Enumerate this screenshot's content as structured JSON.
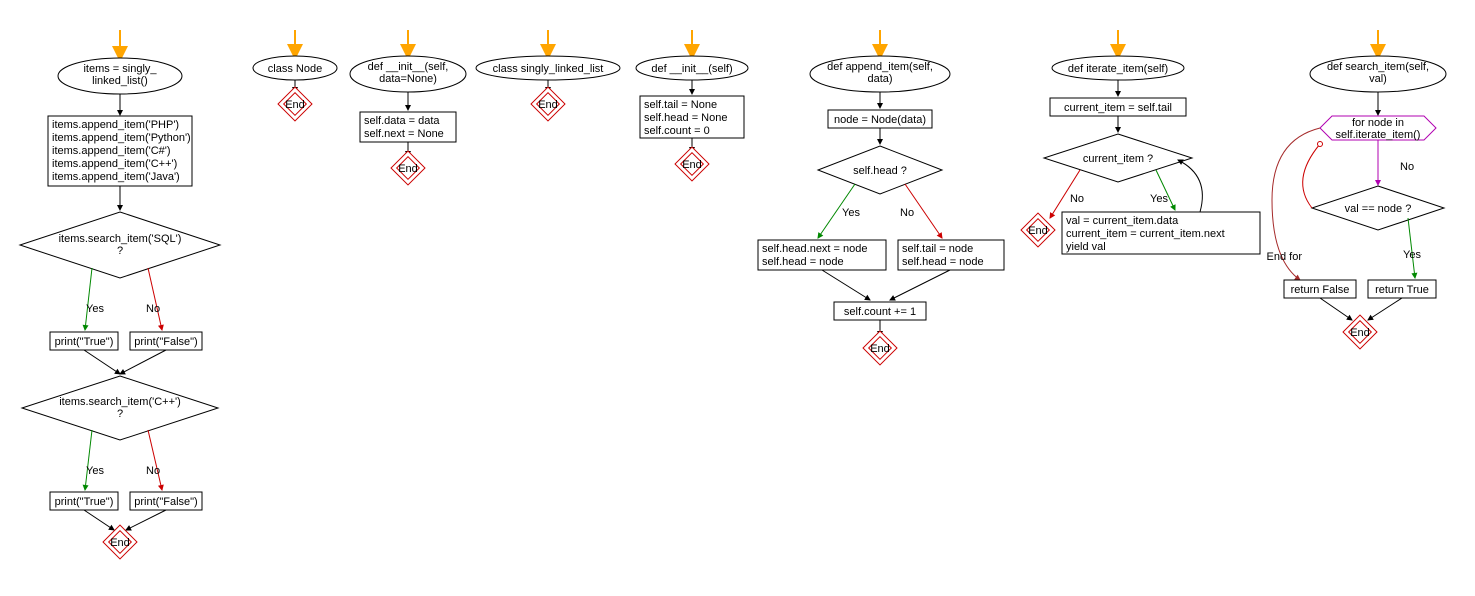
{
  "fc1": {
    "start_text_1": "items = singly_",
    "start_text_2": "linked_list()",
    "proc1": [
      "items.append_item('PHP')",
      "items.append_item('Python')",
      "items.append_item('C#')",
      "items.append_item('C++')",
      "items.append_item('Java')"
    ],
    "dec1_1": "items.search_item('SQL')",
    "dec1_2": "?",
    "yes": "Yes",
    "no": "No",
    "p_true": "print(\"True\")",
    "p_false": "print(\"False\")",
    "dec2_1": "items.search_item('C++')",
    "dec2_2": "?",
    "end": "End"
  },
  "fc2": {
    "start": "class Node",
    "end": "End"
  },
  "fc3": {
    "start_1": "def __init__(self,",
    "start_2": "data=None)",
    "proc": [
      "self.data = data",
      "self.next = None"
    ],
    "end": "End"
  },
  "fc4": {
    "start": "class singly_linked_list",
    "end": "End"
  },
  "fc5": {
    "start": "def __init__(self)",
    "proc": [
      "self.tail = None",
      "self.head = None",
      "self.count = 0"
    ],
    "end": "End"
  },
  "fc6": {
    "start_1": "def append_item(self,",
    "start_2": "data)",
    "proc1": "node = Node(data)",
    "dec": "self.head ?",
    "yes": "Yes",
    "no": "No",
    "yes_box": [
      "self.head.next = node",
      "self.head = node"
    ],
    "no_box": [
      "self.tail = node",
      "self.head = node"
    ],
    "join": "self.count += 1",
    "end": "End"
  },
  "fc7": {
    "start": "def iterate_item(self)",
    "proc1": "current_item = self.tail",
    "dec": "current_item ?",
    "yes": "Yes",
    "no": "No",
    "loop": [
      "val = current_item.data",
      "current_item = current_item.next",
      "yield val"
    ],
    "end": "End"
  },
  "fc8": {
    "start_1": "def search_item(self,",
    "start_2": "val)",
    "loop_1": "for node in",
    "loop_2": "self.iterate_item()",
    "no": "No",
    "dec": "val == node ?",
    "yes": "Yes",
    "endfor": "End for",
    "ret_false": "return False",
    "ret_true": "return True",
    "end": "End"
  }
}
